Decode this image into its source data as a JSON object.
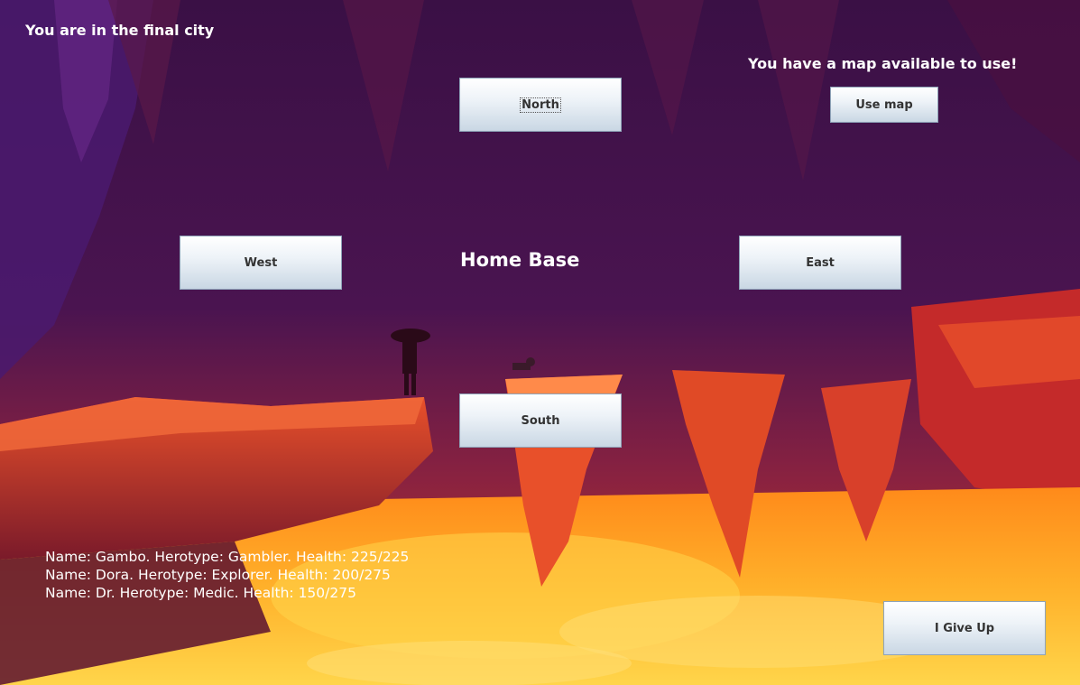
{
  "status": {
    "location_title": "You are in the final city",
    "map_message": "You have a map available to use!",
    "current_area": "Home Base"
  },
  "buttons": {
    "north": "North",
    "west": "West",
    "east": "East",
    "south": "South",
    "use_map": "Use map",
    "give_up": "I Give Up"
  },
  "party": [
    "Name: Gambo. Herotype: Gambler. Health: 225/225",
    "Name: Dora. Herotype: Explorer. Health: 200/275",
    "Name: Dr. Herotype: Medic. Health: 150/275"
  ],
  "colors": {
    "sky_top": "#3a1045",
    "sky_mid": "#6a1a4a",
    "lava_bright": "#ffd23f",
    "lava_orange": "#ff7a1a",
    "rock_red": "#c9302a"
  }
}
